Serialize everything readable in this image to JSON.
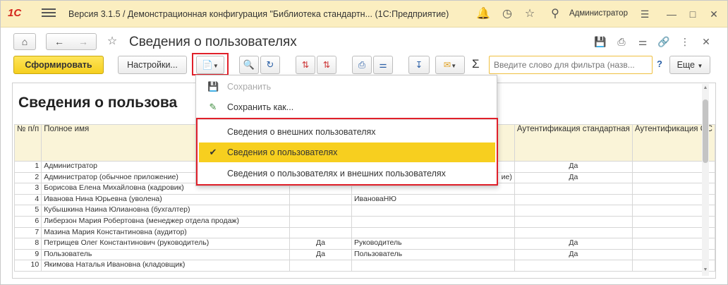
{
  "titlebar": {
    "logo": "1С",
    "title": "Версия 3.1.5 / Демонстрационная конфигурация \"Библиотека стандартн...  (1С:Предприятие)",
    "user": "Администратор"
  },
  "form": {
    "title": "Сведения о пользователях"
  },
  "toolbar": {
    "generate_label": "Сформировать",
    "settings_label": "Настройки...",
    "filter_placeholder": "Введите слово для фильтра (назв...",
    "help_label": "?",
    "more_label": "Еще",
    "sigma": "Σ"
  },
  "dropdown": {
    "items": [
      {
        "label": "Сохранить",
        "icon": "save-icon",
        "disabled": true
      },
      {
        "label": "Сохранить как...",
        "icon": "save-as-icon",
        "disabled": false
      },
      {
        "label": "Сведения о внешних пользователях",
        "icon": "",
        "disabled": false
      },
      {
        "label": "Сведения о пользователях",
        "icon": "checkmark-icon",
        "selected": true
      },
      {
        "label": "Сведения о пользователях и внешних пользователях",
        "icon": "",
        "disabled": false
      }
    ]
  },
  "report": {
    "title": "Сведения о пользова",
    "columns": {
      "num": "№ п/п",
      "fullname": "Полное имя",
      "auth_std": "Аутентификация стандартная",
      "auth_os": "Аутентификация ОС"
    },
    "rows": [
      {
        "n": "1",
        "name": "Администратор",
        "c2": "",
        "c3": "",
        "std": "Да"
      },
      {
        "n": "2",
        "name": "Администратор (обычное приложение)",
        "c2": "",
        "c3": "ие)",
        "std": "Да"
      },
      {
        "n": "3",
        "name": "Борисова Елена Михайловна (кадровик)",
        "c2": "",
        "c3": "",
        "std": ""
      },
      {
        "n": "4",
        "name": "Иванова Нина Юрьевна (уволена)",
        "c2": "",
        "c3": "ИвановаНЮ",
        "std": ""
      },
      {
        "n": "5",
        "name": "Кубышкина Наина Юлиановна (бухгалтер)",
        "c2": "",
        "c3": "",
        "std": ""
      },
      {
        "n": "6",
        "name": "Либерзон Мария Робертовна (менеджер отдела продаж)",
        "c2": "",
        "c3": "",
        "std": ""
      },
      {
        "n": "7",
        "name": "Мазина Мария Константиновна (аудитор)",
        "c2": "",
        "c3": "",
        "std": ""
      },
      {
        "n": "8",
        "name": "Петрищев Олег Константинович (руководитель)",
        "c2": "Да",
        "c3": "Руководитель",
        "std": "Да"
      },
      {
        "n": "9",
        "name": "Пользователь",
        "c2": "Да",
        "c3": "Пользователь",
        "std": "Да"
      },
      {
        "n": "10",
        "name": "Якимова Наталья Ивановна (кладовщик)",
        "c2": "",
        "c3": "",
        "std": ""
      }
    ]
  },
  "colors": {
    "titlebar_bg": "#fbeec0",
    "primary_button": "#f5cf1f",
    "selected_item": "#f7cf1f",
    "highlight_border": "#e0202a",
    "header_cell_bg": "#faf4d8"
  }
}
